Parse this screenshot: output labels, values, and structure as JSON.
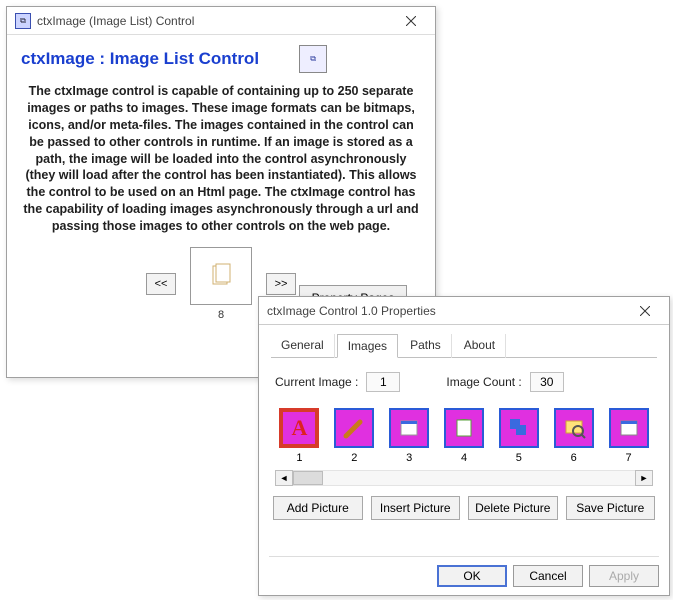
{
  "win1": {
    "title": "ctxImage (Image List) Control",
    "header": "ctxImage : Image List Control",
    "description": "The ctxImage control is capable of containing up to 250 separate images or paths to images. These image formats can be bitmaps, icons, and/or meta-files. The images contained in the control can be passed to other controls in runtime. If an image is stored as a path, the image will be loaded into the control asynchronously (they will load after the control has been instantiated). This allows the control to be used on an Html page. The ctxImage control has the capability of  loading images asynchronously through a url and passing those images to other controls on the web page.",
    "prev": "<<",
    "next": ">>",
    "current_index": "8",
    "property_pages": "Property Pages"
  },
  "win2": {
    "title": "ctxImage Control 1.0 Properties",
    "tabs": {
      "t0": "General",
      "t1": "Images",
      "t2": "Paths",
      "t3": "About"
    },
    "current_image_label": "Current Image :",
    "current_image_value": "1",
    "image_count_label": "Image Count :",
    "image_count_value": "30",
    "thumbs": {
      "1": "1",
      "2": "2",
      "3": "3",
      "4": "4",
      "5": "5",
      "6": "6",
      "7": "7"
    },
    "buttons": {
      "add": "Add Picture",
      "insert": "Insert Picture",
      "delete": "Delete Picture",
      "save": "Save Picture"
    },
    "dlg": {
      "ok": "OK",
      "cancel": "Cancel",
      "apply": "Apply"
    }
  }
}
